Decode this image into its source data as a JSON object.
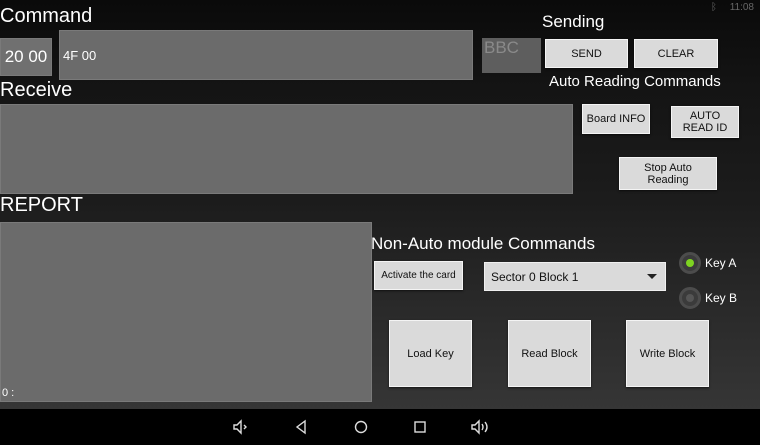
{
  "status": {
    "bluetooth": "ᛒ",
    "time": "11:08"
  },
  "command": {
    "title": "Command",
    "prefix": "20 00",
    "value": "4F 00",
    "bbc": "BBC"
  },
  "sending": {
    "title": "Sending",
    "send_label": "SEND",
    "clear_label": "CLEAR"
  },
  "auto": {
    "title": "Auto Reading Commands",
    "board_info_label": "Board INFO",
    "auto_read_id_label": "AUTO READ ID",
    "stop_auto_label": "Stop Auto Reading"
  },
  "receive": {
    "title": "Receive",
    "value": ""
  },
  "report": {
    "title": "REPORT",
    "value": "0 :"
  },
  "nonauto": {
    "title": "Non-Auto module Commands",
    "activate_label": "Activate the card",
    "sector_selected": "Sector 0 Block 1",
    "key_a_label": "Key A",
    "key_b_label": "Key B",
    "key_selected": "Key A",
    "load_key_label": "Load Key",
    "read_block_label": "Read Block",
    "write_block_label": "Write Block"
  },
  "colors": {
    "radio_on": "#7ed321",
    "radio_off": "#555555"
  },
  "navbar": {
    "icons": [
      "volume-down-icon",
      "back-icon",
      "home-icon",
      "recents-icon",
      "volume-up-icon"
    ]
  }
}
